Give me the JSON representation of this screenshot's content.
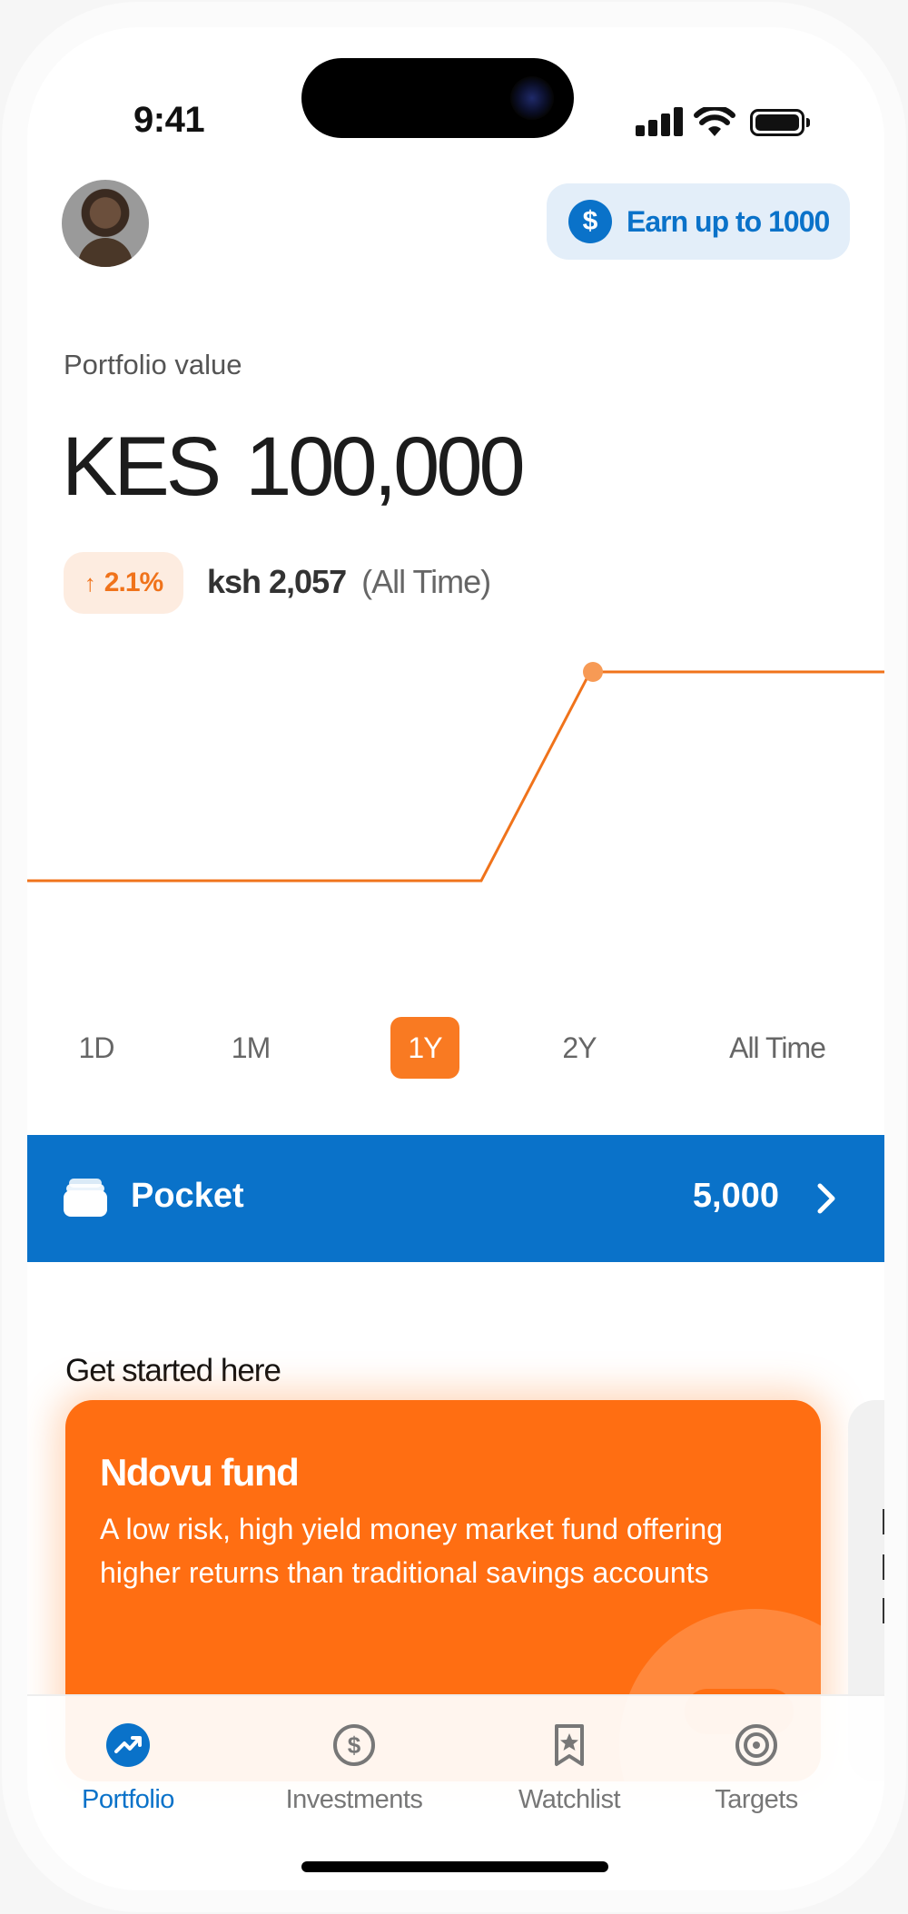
{
  "status_bar": {
    "time": "9:41"
  },
  "header": {
    "earn_button_label": "Earn up to 1000",
    "coin_symbol": "$"
  },
  "portfolio": {
    "label": "Portfolio value",
    "currency": "KES",
    "amount": "100,000",
    "change_percent": "2.1%",
    "change_amount": "ksh 2,057",
    "change_period": "(All Time)"
  },
  "chart_data": {
    "type": "line",
    "series": [
      {
        "values": [
          0,
          0,
          0,
          0,
          0,
          0,
          1,
          1,
          1
        ]
      }
    ],
    "highlight_index": 6,
    "color": "#f0731b",
    "grid": false
  },
  "periods": {
    "selected": "1Y",
    "tabs": [
      "1D",
      "1M",
      "1Y",
      "2Y",
      "All Time"
    ]
  },
  "pocket": {
    "title": "Pocket",
    "value": "5,000"
  },
  "get_started": {
    "title": "Get started here",
    "card": {
      "name": "Ndovu fund",
      "description": "A low risk, high yield money market fund offering higher returns than traditional savings accounts"
    }
  },
  "nav": {
    "items": [
      {
        "label": "Portfolio",
        "icon": "trending-up-icon",
        "active": true
      },
      {
        "label": "Investments",
        "icon": "dollar-circle-icon",
        "active": false
      },
      {
        "label": "Watchlist",
        "icon": "bookmark-star-icon",
        "active": false
      },
      {
        "label": "Targets",
        "icon": "target-icon",
        "active": false
      }
    ]
  },
  "colors": {
    "accent": "#f97a22",
    "primary": "#0a72c9"
  }
}
